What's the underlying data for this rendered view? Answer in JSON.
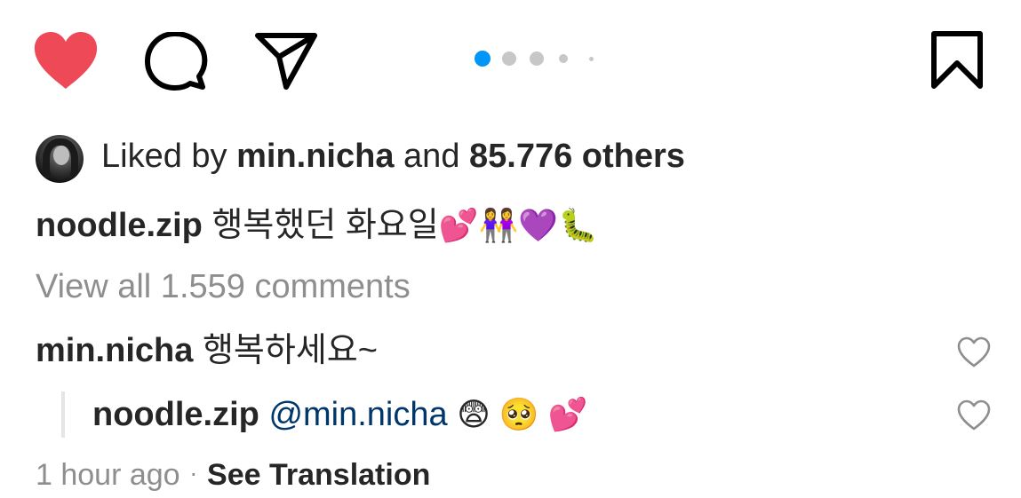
{
  "actions": {
    "like_icon": "heart-filled-icon",
    "comment_icon": "comment-bubble-icon",
    "share_icon": "paper-plane-icon",
    "save_icon": "bookmark-icon",
    "like_color": "#ed4956"
  },
  "carousel": {
    "active_index": 0,
    "count": 5,
    "active_color": "#0095f6",
    "inactive_color": "#c7c7c7"
  },
  "likes": {
    "prefix": "Liked by",
    "liker": "min.nicha",
    "connector": "and",
    "others": "85.776 others"
  },
  "caption": {
    "username": "noodle.zip",
    "text": "행복했던 화요일",
    "emojis": "💕👭💜🐛"
  },
  "view_comments": "View all 1.559 comments",
  "comment": {
    "username": "min.nicha",
    "text": "행복하세요~"
  },
  "reply": {
    "username": "noodle.zip",
    "mention": "@min.nicha",
    "emojis": "😨 🥺 💕"
  },
  "footer": {
    "time": "1 hour ago",
    "separator": "·",
    "translate": "See Translation"
  }
}
